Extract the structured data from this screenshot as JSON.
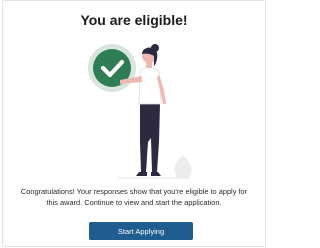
{
  "heading": "You are eligible!",
  "illustration": {
    "check_icon": "check-icon",
    "accent_color": "#2e7d55",
    "accent_ring_color": "#d8e6de"
  },
  "message": "Congratulations! Your responses show that you're eligible to apply for this award. Continue to view and start the application.",
  "primary_button": {
    "label": "Start Applying",
    "color": "#1f5c8f"
  }
}
